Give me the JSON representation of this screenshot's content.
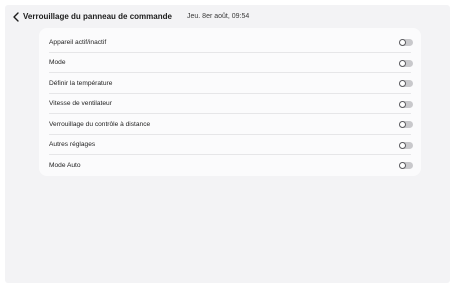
{
  "header": {
    "title": "Verrouillage du panneau de commande",
    "datetime": "Jeu. 8er août, 09:54",
    "back_icon": "chevron-left-icon"
  },
  "settings": [
    {
      "label": "Appareil actif/inactif",
      "enabled": false
    },
    {
      "label": "Mode",
      "enabled": false
    },
    {
      "label": "Définir la température",
      "enabled": false
    },
    {
      "label": "Vitesse de ventilateur",
      "enabled": false
    },
    {
      "label": "Verrouillage du contrôle à distance",
      "enabled": false
    },
    {
      "label": "Autres réglages",
      "enabled": false
    },
    {
      "label": "Mode Auto",
      "enabled": false
    }
  ],
  "colors": {
    "background": "#f3f3f5",
    "card": "#fbfbfc",
    "toggle_off_track": "#c9c9cc"
  }
}
